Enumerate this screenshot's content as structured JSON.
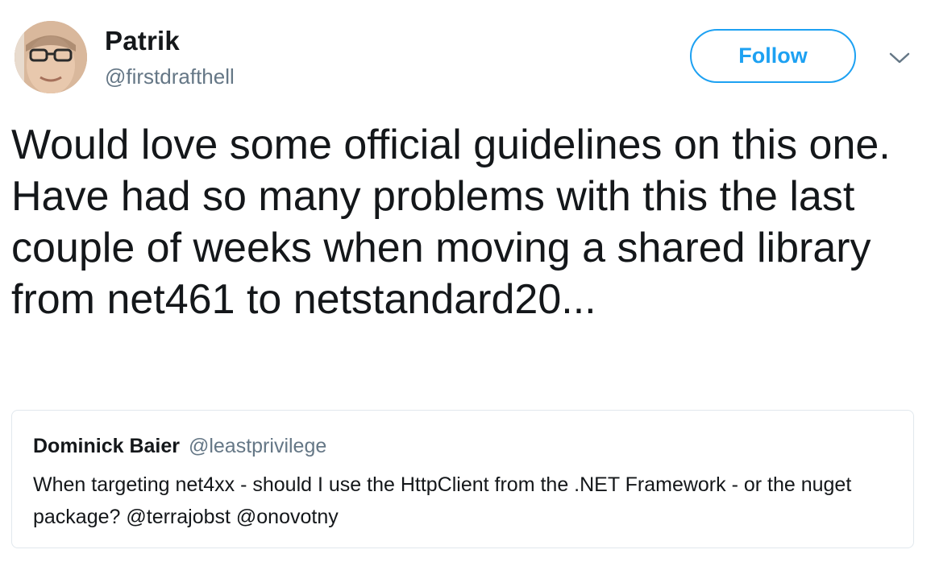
{
  "tweet": {
    "author": {
      "name": "Patrik",
      "handle": "@firstdrafthell",
      "avatar": "avatar-photo"
    },
    "follow_label": "Follow",
    "menu_icon": "chevron-down-icon",
    "text": "Would love some official guidelines on this one. Have had so many problems with this the last couple of weeks when moving a shared library from net461 to netstandard20...",
    "quoted": {
      "name": "Dominick Baier",
      "handle": "@leastprivilege",
      "text": "When targeting net4xx - should I use the HttpClient from the .NET Framework - or the nuget package? @terrajobst @onovotny"
    }
  },
  "colors": {
    "accent": "#1da1f2",
    "text": "#14171a",
    "secondary_text": "#657786",
    "border": "#e1e8ed"
  }
}
